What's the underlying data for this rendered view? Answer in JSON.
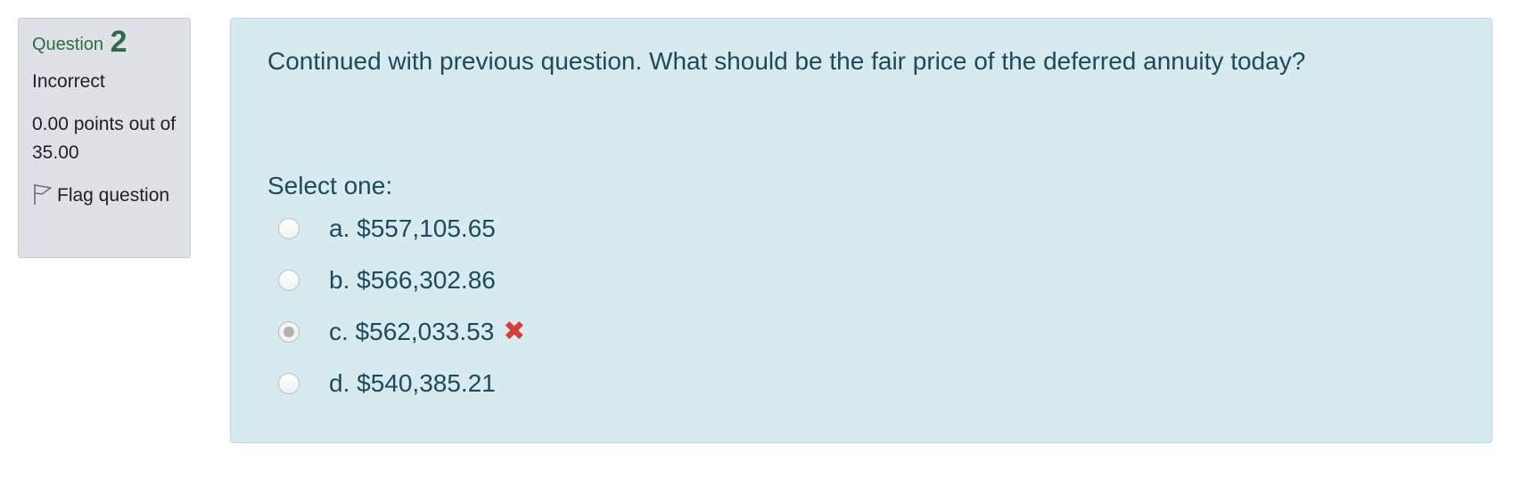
{
  "info": {
    "question_label": "Question",
    "question_number": "2",
    "state": "Incorrect",
    "grade": "0.00 points out of 35.00",
    "flag_label": "Flag question"
  },
  "question": {
    "text": "Continued with previous question. What should be the fair price of the deferred annuity today?",
    "prompt": "Select one:",
    "answers": [
      {
        "label": "a. $557,105.65",
        "selected": false
      },
      {
        "label": "b. $566,302.86",
        "selected": false
      },
      {
        "label": "c. $562,033.53",
        "selected": true,
        "status": "incorrect"
      },
      {
        "label": "d. $540,385.21",
        "selected": false
      }
    ],
    "incorrect_color": "#d43f3a",
    "accent_color": "#2e6b46"
  }
}
